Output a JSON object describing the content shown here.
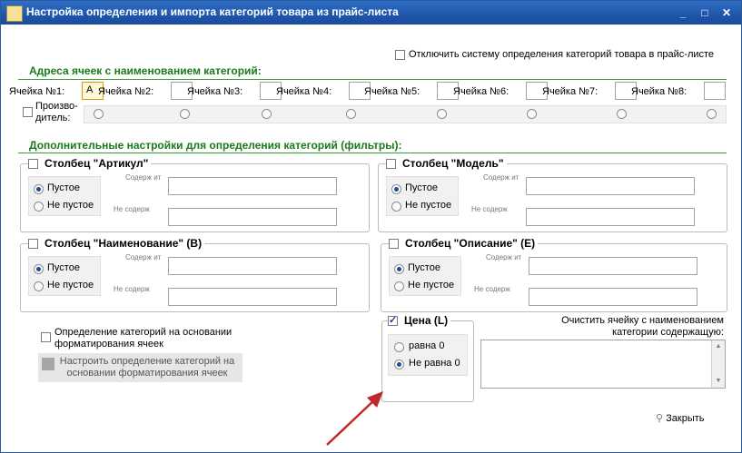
{
  "window": {
    "title": "Настройка определения и импорта категорий товара из прайс-листа",
    "buttons": [
      "_",
      "□",
      "✕"
    ]
  },
  "disable_system": {
    "label": "Отключить систему определения категорий товара в прайс-листе",
    "checked": false
  },
  "cells_section": {
    "title": "Адреса ячеек с наименованием категорий:",
    "cells": [
      {
        "label": "Ячейка №1:",
        "value": "A"
      },
      {
        "label": "Ячейка №2:",
        "value": ""
      },
      {
        "label": "Ячейка №3:",
        "value": ""
      },
      {
        "label": "Ячейка №4:",
        "value": ""
      },
      {
        "label": "Ячейка №5:",
        "value": ""
      },
      {
        "label": "Ячейка №6:",
        "value": ""
      },
      {
        "label": "Ячейка №7:",
        "value": ""
      },
      {
        "label": "Ячейка №8:",
        "value": ""
      }
    ],
    "manufacturer_label": "Произво-\nдитель:"
  },
  "filters_section": {
    "title": "Дополнительные настройки для определения категорий (фильтры):",
    "groups": [
      {
        "name": "Столбец \"Артикул\"",
        "option_empty": "Пустое",
        "option_not_empty": "Не пустое",
        "contains_label": "Содерж ит",
        "not_contains_label": "Не содерж"
      },
      {
        "name": "Столбец \"Модель\"",
        "option_empty": "Пустое",
        "option_not_empty": "Не пустое",
        "contains_label": "Содерж ит",
        "not_contains_label": "Не содерж"
      },
      {
        "name": "Столбец \"Наименование\" (B)",
        "option_empty": "Пустое",
        "option_not_empty": "Не пустое",
        "contains_label": "Содерж ит",
        "not_contains_label": "Не содерж"
      },
      {
        "name": "Столбец \"Описание\" (E)",
        "option_empty": "Пустое",
        "option_not_empty": "Не пустое",
        "contains_label": "Содерж ит",
        "not_contains_label": "Не содерж"
      }
    ]
  },
  "formatting": {
    "checkbox_label": "Определение категорий на основании форматирования ячеек",
    "configure_button": "Настроить определение категорий на основании форматирования ячеек"
  },
  "price": {
    "name": "Цена (L)",
    "checked": true,
    "option_zero": "равна 0",
    "option_nonzero": "Не равна 0",
    "selected": "Не равна 0"
  },
  "clear_cell": {
    "label": "Очистить ячейку с наименованием категории содержащую:"
  },
  "close_button": "Закрыть",
  "colors": {
    "title_bar": "#1f56ab",
    "section_title": "#1a7a1a",
    "arrow": "#c0282a"
  }
}
